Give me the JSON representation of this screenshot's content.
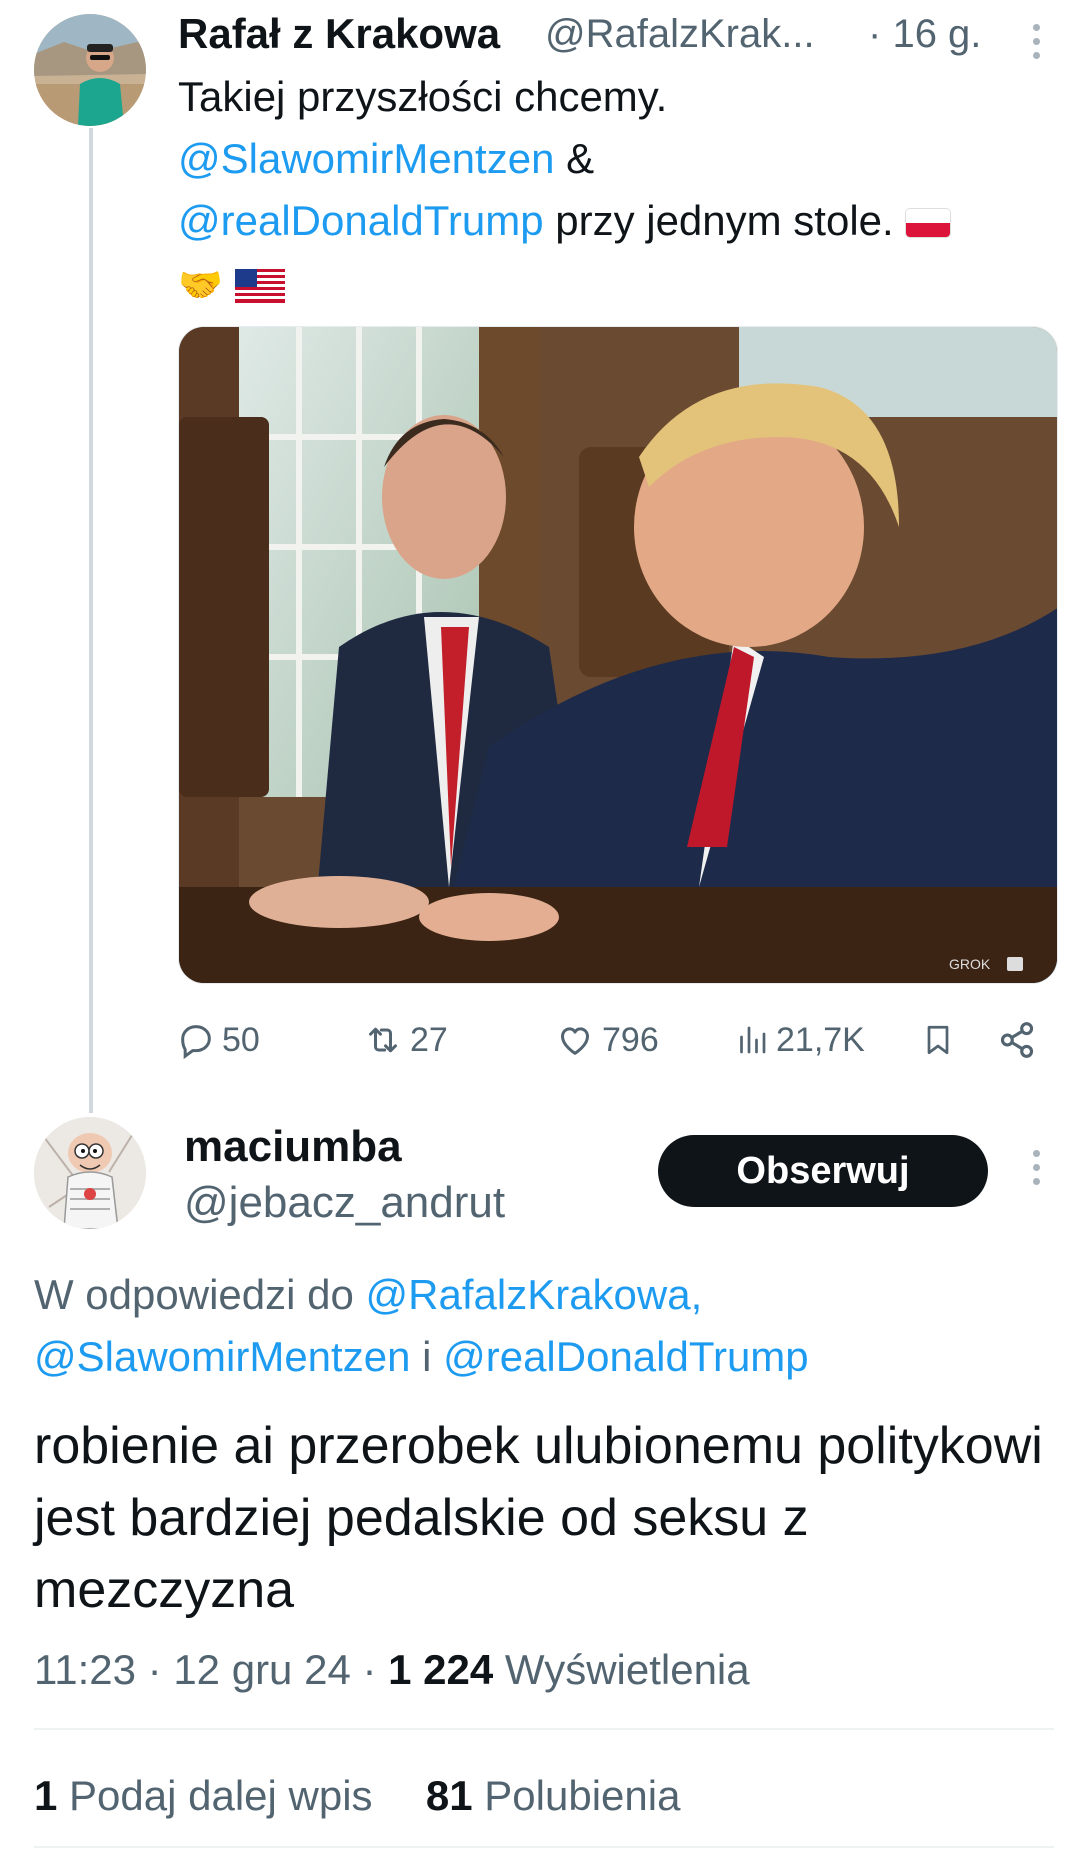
{
  "tweet1": {
    "author_name": "Rafał z Krakowa",
    "author_handle": "@RafalzKrak...",
    "time_sep": "·",
    "time_ago": "16 g.",
    "text_line1": "Takiej przyszłości chcemy.",
    "mention1": "@SlawomirMentzen",
    "amp": " &",
    "mention2": "@realDonaldTrump",
    "text_after": " przy jednym stole. ",
    "emoji_handshake": "🤝",
    "media_watermark": "GROK",
    "actions": {
      "replies": "50",
      "reposts": "27",
      "likes": "796",
      "views": "21,7K"
    }
  },
  "tweet2": {
    "author_name": "maciumba",
    "author_handle": "@jebacz_andrut",
    "follow_label": "Obserwuj",
    "reply_prefix": "W odpowiedzi do ",
    "reply_mention1": "@RafalzKrakowa,",
    "reply_mention2": "@SlawomirMentzen",
    "reply_and": " i ",
    "reply_mention3": "@realDonaldTrump",
    "text": "robienie ai przerobek ulubionemu politykowi jest bardziej pedalskie od seksu z mezczyzna",
    "time": "11:23",
    "sep1": " · ",
    "date": "12 gru 24",
    "sep2": " · ",
    "views_count": "1 224",
    "views_label": " Wyświetlenia",
    "reposts_count": "1",
    "reposts_label": " Podaj dalej wpis",
    "likes_count": "81",
    "likes_label": " Polubienia"
  },
  "colors": {
    "link": "#1d9bf0",
    "muted": "#536471",
    "text": "#0f1419",
    "button_bg": "#0f1419"
  },
  "icons": [
    "reply-icon",
    "repost-icon",
    "like-icon",
    "views-icon",
    "bookmark-icon",
    "share-icon",
    "more-icon"
  ]
}
